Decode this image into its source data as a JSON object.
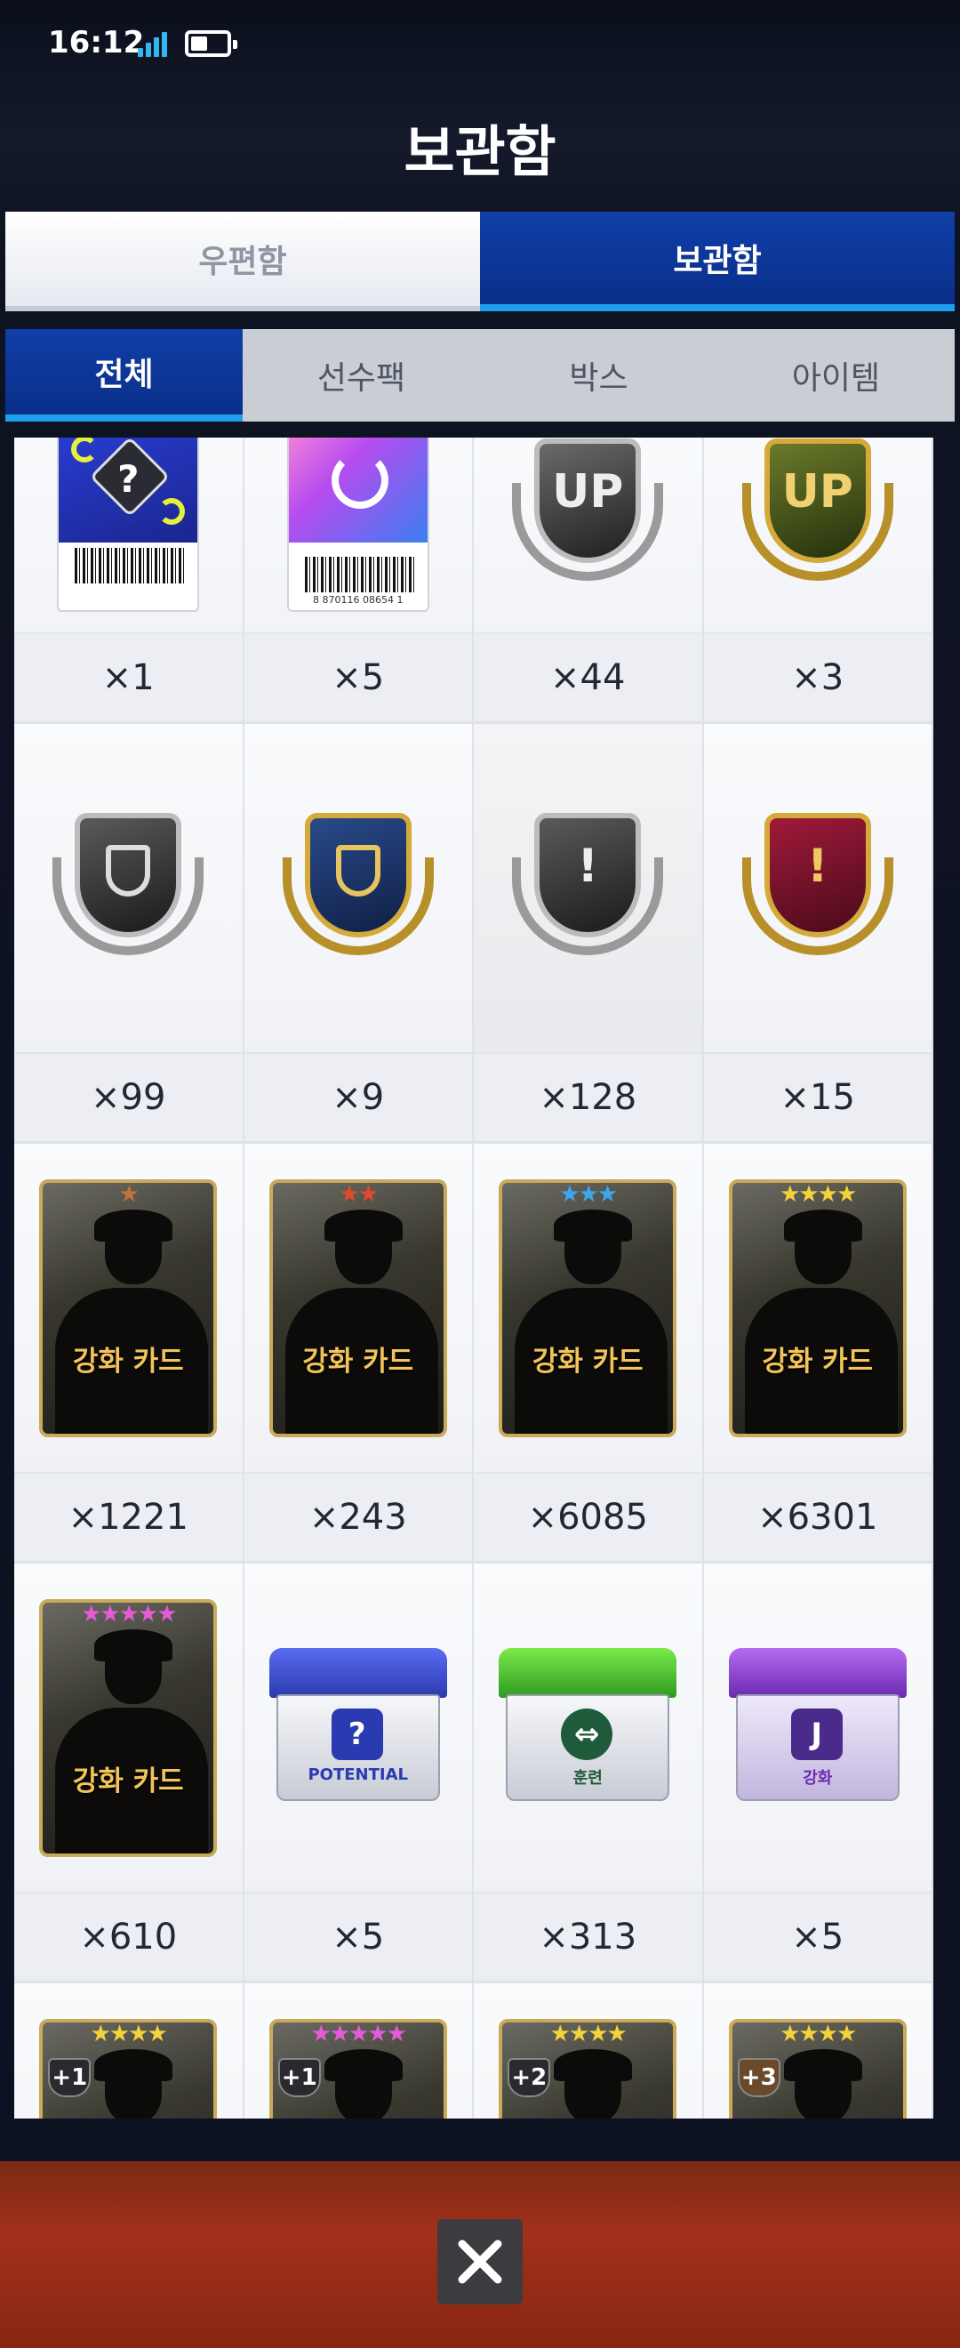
{
  "status": {
    "time": "16:12"
  },
  "title": "보관함",
  "main_tabs": [
    {
      "label": "우편함",
      "active": false
    },
    {
      "label": "보관함",
      "active": true
    }
  ],
  "sub_tabs": [
    {
      "label": "전체",
      "active": true
    },
    {
      "label": "선수팩",
      "active": false
    },
    {
      "label": "박스",
      "active": false
    },
    {
      "label": "아이템",
      "active": false
    }
  ],
  "items": {
    "row1": [
      {
        "name": "live-pack-ticket",
        "count": "×1"
      },
      {
        "name": "change-ticket",
        "count": "×5",
        "barcode_text": "8 870116 08654 1"
      },
      {
        "name": "up-badge-silver",
        "count": "×44",
        "glyph": "UP"
      },
      {
        "name": "up-badge-gold",
        "count": "×3",
        "glyph": "UP"
      }
    ],
    "row2": [
      {
        "name": "shield-badge-silver",
        "count": "×99"
      },
      {
        "name": "shield-badge-gold",
        "count": "×9"
      },
      {
        "name": "alert-badge-silver",
        "count": "×128"
      },
      {
        "name": "alert-badge-gold",
        "count": "×15"
      }
    ],
    "row3": [
      {
        "name": "enhance-card-1star",
        "label": "강화 카드",
        "stars": "★",
        "count": "×1221"
      },
      {
        "name": "enhance-card-2star",
        "label": "강화 카드",
        "stars": "★★",
        "count": "×243"
      },
      {
        "name": "enhance-card-3star",
        "label": "강화 카드",
        "stars": "★★★",
        "count": "×6085"
      },
      {
        "name": "enhance-card-4star",
        "label": "강화 카드",
        "stars": "★★★★",
        "count": "×6301"
      }
    ],
    "row4": [
      {
        "name": "enhance-card-5star",
        "label": "강화 카드",
        "stars": "★★★★★",
        "count": "×610"
      },
      {
        "name": "potential-box",
        "label": "POTENTIAL",
        "count": "×5"
      },
      {
        "name": "training-box",
        "label": "훈련",
        "count": "×313"
      },
      {
        "name": "enhance-box",
        "label": "강화",
        "count": "×5"
      }
    ],
    "row5": [
      {
        "name": "plus1-card-4star",
        "badge": "+1",
        "stars": "★★★★"
      },
      {
        "name": "plus1-card-5star",
        "badge": "+1",
        "stars": "★★★★★"
      },
      {
        "name": "plus2-card-4star",
        "badge": "+2",
        "stars": "★★★★"
      },
      {
        "name": "plus3-card-4star",
        "badge": "+3",
        "stars": "★★★★"
      }
    ]
  },
  "colors": {
    "accent_blue": "#0a2f8a",
    "accent_cyan": "#1ea0f0",
    "star_bronze": "#c0723a",
    "star_red": "#e24a2a",
    "star_blue": "#3aa8f0",
    "star_gold": "#f2d43a",
    "star_pink": "#e65ad8"
  },
  "close_icon": "close-icon"
}
